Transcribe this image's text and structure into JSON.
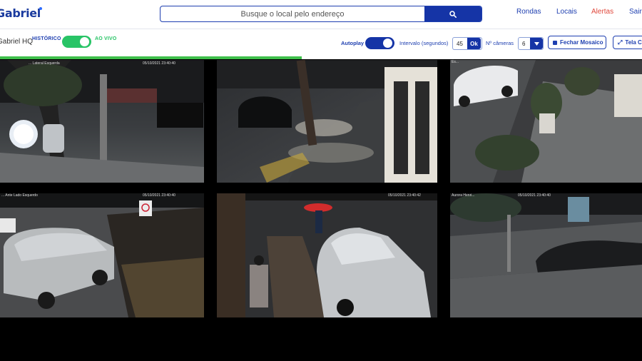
{
  "header": {
    "logo_text": "Gabriel",
    "search": {
      "placeholder": "Busque o local pelo endereço",
      "button_icon": "search-icon"
    },
    "nav": [
      "Rondas",
      "Locais",
      "Alertas",
      "Sair"
    ]
  },
  "toolbar": {
    "location": "Gabriel HQ",
    "mode_left": "HISTÓRICO",
    "mode_right": "AO VIVO",
    "mode_live_on": true,
    "autoplay_label": "Autoplay",
    "autoplay_on": true,
    "interval_label": "Intervalo (segundos)",
    "interval_value": "45",
    "ok_label": "Ok",
    "cameras_label": "Nº câmeras",
    "cameras_value": "6",
    "close_mosaic_label": "Fechar Mosaico",
    "fullscreen_label": "Tela Cheia",
    "autoplay_progress": 0.47
  },
  "cameras": [
    {
      "label": "... Lateral Esquerda",
      "timestamp": "05/10/2021 23:40:40"
    },
    {
      "label": "",
      "timestamp": ""
    },
    {
      "label": "Es...",
      "timestamp": ""
    },
    {
      "label": "... Ante Lado Esquerdo",
      "timestamp": "05/10/2021 23:40:40"
    },
    {
      "label": "",
      "timestamp": "05/10/2021 23:40:42"
    },
    {
      "label": "Aurora Henri...",
      "timestamp": "05/10/2021 23:40:40"
    }
  ],
  "colors": {
    "brand": "#1e3fb0",
    "button": "#1534a6",
    "live_toggle": "#28c466",
    "alert": "#e0483c",
    "progress": "#3fbf4b"
  }
}
